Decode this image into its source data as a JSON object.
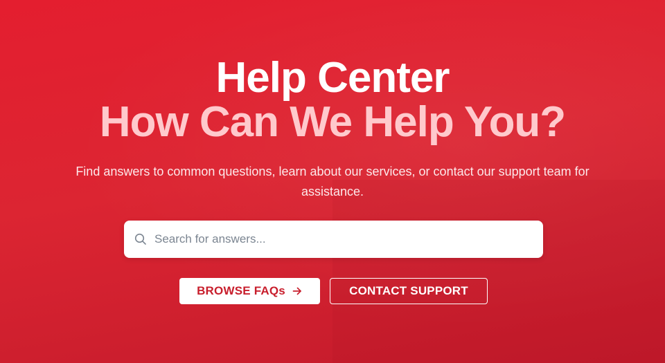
{
  "hero": {
    "title": "Help Center",
    "subtitle": "How Can We Help You?",
    "description": "Find answers to common questions, learn about our services, or contact our support team for assistance."
  },
  "search": {
    "placeholder": "Search for answers...",
    "value": "",
    "icon": "search-icon"
  },
  "actions": {
    "browse_label": "BROWSE FAQs",
    "browse_icon": "arrow-right-icon",
    "contact_label": "CONTACT SUPPORT"
  },
  "colors": {
    "background": "#dc2532",
    "accent_text": "#ffc9cc",
    "primary_button_text": "#c81e2c"
  }
}
